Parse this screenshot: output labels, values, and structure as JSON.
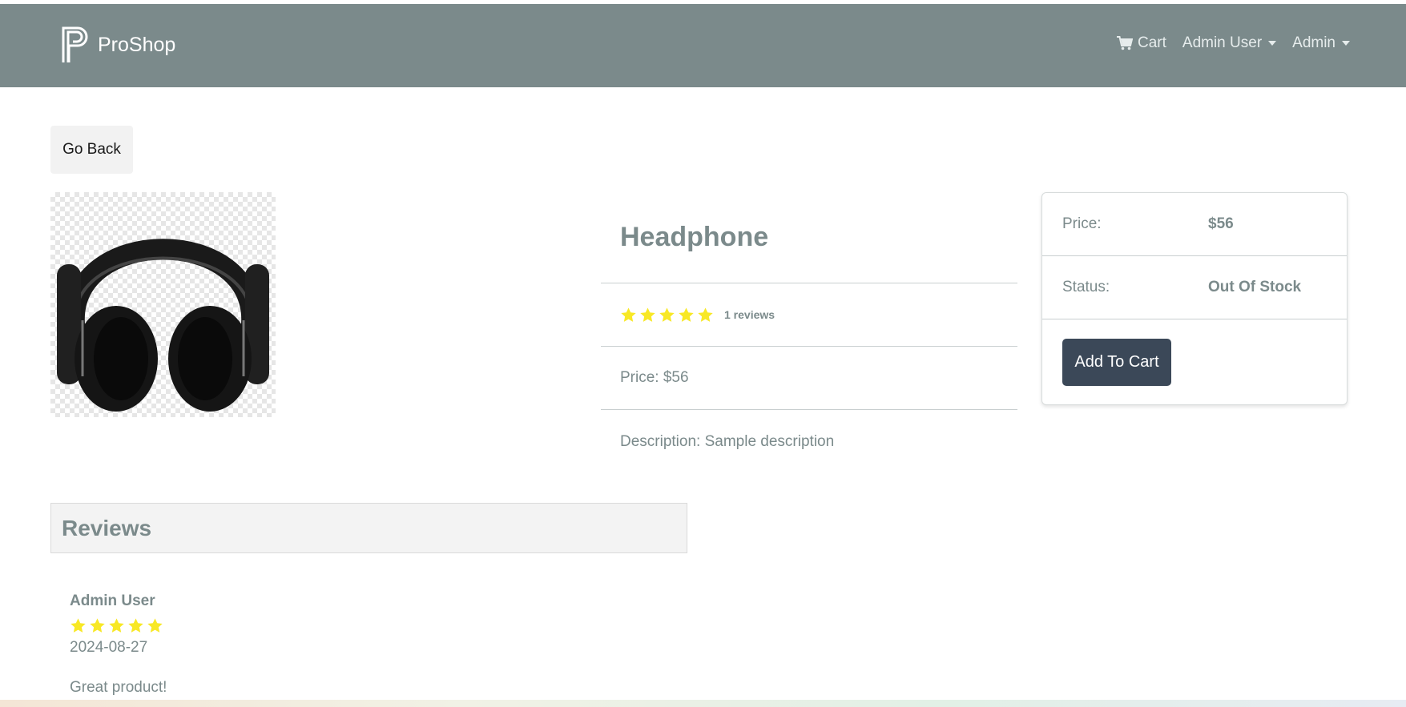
{
  "navbar": {
    "brand": "ProShop",
    "cart_label": "Cart",
    "user_menu_label": "Admin User",
    "admin_menu_label": "Admin"
  },
  "go_back_label": "Go Back",
  "product": {
    "image_alt": "Headphone",
    "name": "Headphone",
    "rating": 5,
    "reviews_text": "1 reviews",
    "price_text": "Price: $56",
    "description_text": "Description: Sample description"
  },
  "purchase_card": {
    "price_label": "Price:",
    "price_value": "$56",
    "status_label": "Status:",
    "status_value": "Out Of Stock",
    "add_to_cart_label": "Add To Cart"
  },
  "reviews": {
    "heading": "Reviews",
    "items": [
      {
        "name": "Admin User",
        "rating": 5,
        "date": "2024-08-27",
        "comment": "Great product!"
      }
    ]
  },
  "colors": {
    "navbar": "#7b8a8b",
    "star": "#f8e825",
    "button_dark": "#3b4858"
  }
}
